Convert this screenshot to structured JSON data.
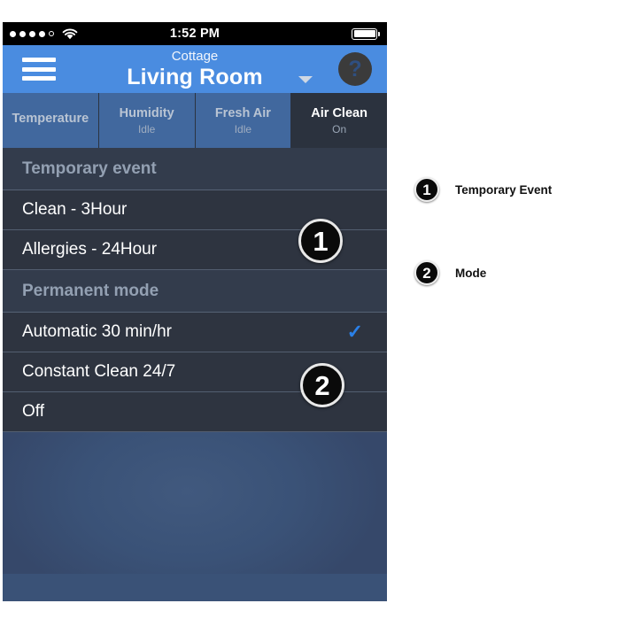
{
  "status_bar": {
    "signal_dots_filled": 4,
    "signal_dots_total": 5,
    "wifi_icon": "wifi-icon",
    "time": "1:52 PM",
    "battery_icon": "battery-full-icon"
  },
  "nav_bar": {
    "menu_icon": "hamburger-menu-icon",
    "subtitle": "Cottage",
    "title": "Living Room",
    "caret_icon": "chevron-down-icon",
    "help_label": "?",
    "background_color": "#4a8ce0"
  },
  "tabs": [
    {
      "label": "Temperature",
      "sub": "",
      "active": false
    },
    {
      "label": "Humidity",
      "sub": "Idle",
      "active": false
    },
    {
      "label": "Fresh Air",
      "sub": "Idle",
      "active": false
    },
    {
      "label": "Air Clean",
      "sub": "On",
      "active": true
    }
  ],
  "sections": [
    {
      "header": "Temporary event",
      "rows": [
        {
          "label": "Clean - 3Hour",
          "checked": false
        },
        {
          "label": "Allergies - 24Hour",
          "checked": false
        }
      ]
    },
    {
      "header": "Permanent mode",
      "rows": [
        {
          "label": "Automatic 30 min/hr",
          "checked": true
        },
        {
          "label": "Constant Clean 24/7",
          "checked": false
        },
        {
          "label": "Off",
          "checked": false
        }
      ]
    }
  ],
  "check_glyph": "✓",
  "callouts": [
    {
      "number": "1"
    },
    {
      "number": "2"
    }
  ],
  "legend": [
    {
      "number": "1",
      "label": "Temporary Event"
    },
    {
      "number": "2",
      "label": "Mode"
    }
  ],
  "colors": {
    "accent_blue": "#4a8ce0",
    "tab_blue": "#41689e",
    "list_bg": "#2e3440",
    "section_bg": "#333c4c",
    "filler_bg": "#3a5277",
    "check_blue": "#2a80e8"
  }
}
